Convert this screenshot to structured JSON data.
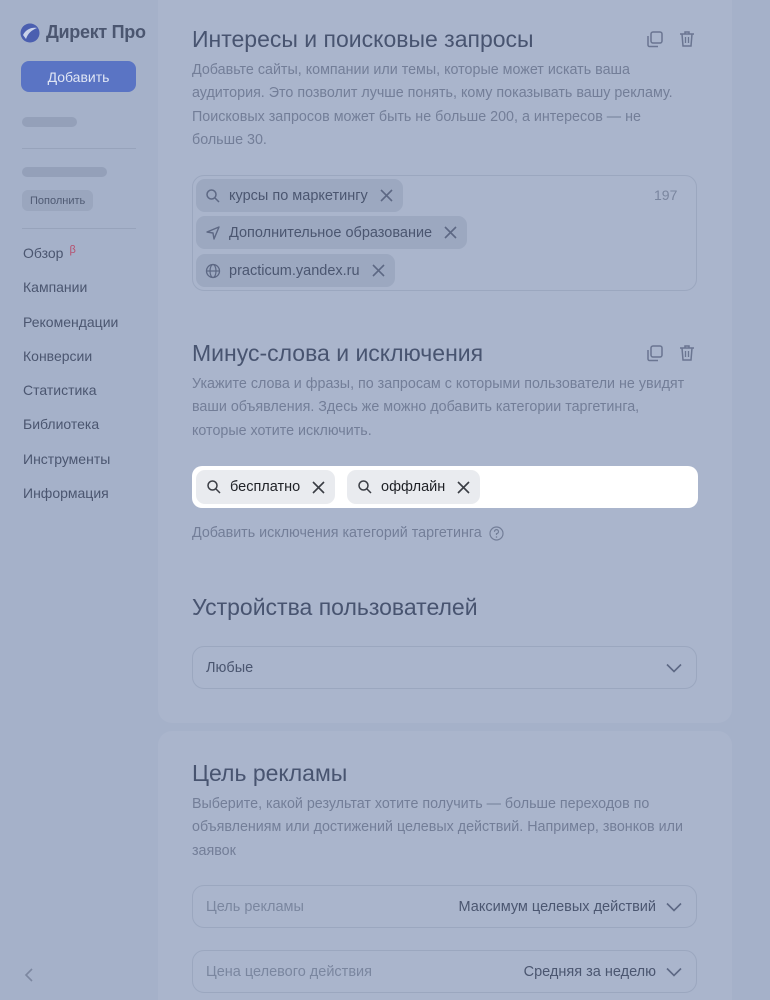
{
  "app": {
    "title": "Директ Про",
    "accent": "#5a74c4"
  },
  "sidebar": {
    "add_label": "Добавить",
    "replenish_label": "Пополнить",
    "items": [
      {
        "label": "Обзор",
        "badge": "β"
      },
      {
        "label": "Кампании"
      },
      {
        "label": "Рекомендации"
      },
      {
        "label": "Конверсии"
      },
      {
        "label": "Статистика"
      },
      {
        "label": "Библиотека"
      },
      {
        "label": "Инструменты"
      },
      {
        "label": "Информация"
      }
    ],
    "collapse_icon": "chevron-left-icon"
  },
  "interests": {
    "title": "Интересы и поисковые запросы",
    "description": "Добавьте сайты, компании или темы, которые может искать ваша аудитория. Это позволит лучше понять, кому показывать вашу рекламу. Поисковых запросов может быть не больше 200, а интересов — не больше 30.",
    "counter": "197",
    "chips": [
      {
        "label": "курсы по маркетингу",
        "icon": "search-icon"
      },
      {
        "label": "Дополнительное образование",
        "icon": "navigation-arrow-icon"
      },
      {
        "label": "practicum.yandex.ru",
        "icon": "globe-icon"
      }
    ]
  },
  "negative": {
    "title": "Минус-слова и исключения",
    "description": "Укажите слова и фразы, по запросам с которыми пользователи не увидят ваши объявления. Здесь же можно добавить категории таргетинга, которые хотите исключить.",
    "chips": [
      {
        "label": "бесплатно",
        "icon": "search-icon"
      },
      {
        "label": "оффлайн",
        "icon": "search-icon"
      }
    ],
    "add_exclusions_label": "Добавить исключения категорий таргетинга"
  },
  "devices": {
    "title": "Устройства пользователей",
    "select_value": "Любые"
  },
  "goal": {
    "title": "Цель рекламы",
    "description": "Выберите, какой результат хотите получить — больше переходов по объявлениям или достижений целевых действий. Например, звонков или заявок",
    "goal_label": "Цель рекламы",
    "goal_value": "Максимум целевых действий",
    "price_label": "Цена целевого действия",
    "price_value": "Средняя за неделю"
  }
}
